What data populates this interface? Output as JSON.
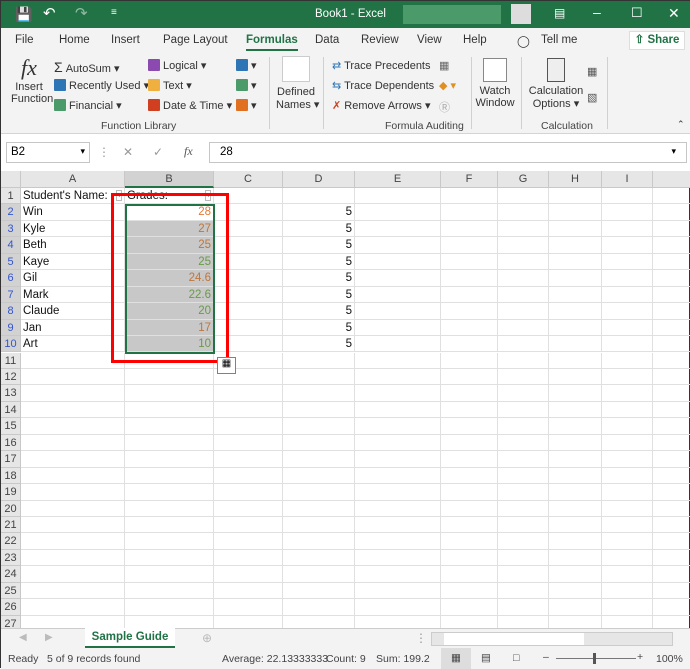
{
  "title": {
    "doc": "Book1 - Excel"
  },
  "tabs": [
    "File",
    "Home",
    "Insert",
    "Page Layout",
    "Formulas",
    "Data",
    "Review",
    "View",
    "Help",
    "Tell me"
  ],
  "share": "Share",
  "ribbon": {
    "insert_function": [
      "Insert",
      "Function"
    ],
    "autosum": "AutoSum",
    "recently_used": "Recently Used",
    "financial": "Financial",
    "logical": "Logical",
    "text": "Text",
    "date_time": "Date & Time",
    "defined_names": [
      "Defined",
      "Names"
    ],
    "trace_precedents": "Trace Precedents",
    "trace_dependents": "Trace Dependents",
    "remove_arrows": "Remove Arrows",
    "watch_window": [
      "Watch",
      "Window"
    ],
    "calc_options": [
      "Calculation",
      "Options"
    ],
    "groups": {
      "function_library": "Function Library",
      "formula_auditing": "Formula Auditing",
      "calculation": "Calculation"
    }
  },
  "formula_bar": {
    "name_box": "B2",
    "fx": "fx",
    "value": "28"
  },
  "columns": [
    "A",
    "B",
    "C",
    "D",
    "E",
    "F",
    "G",
    "H",
    "I"
  ],
  "headers": {
    "a": "Student's Name:",
    "b": "Grades:"
  },
  "rows": [
    {
      "name": "Win",
      "grade": "28",
      "color": "#e07b39",
      "d": "5"
    },
    {
      "name": "Kyle",
      "grade": "27",
      "color": "#c0753a",
      "d": "5"
    },
    {
      "name": "Beth",
      "grade": "25",
      "color": "#c0753a",
      "d": "5"
    },
    {
      "name": "Kaye",
      "grade": "25",
      "color": "#6a9a4a",
      "d": "5"
    },
    {
      "name": "Gil",
      "grade": "24.6",
      "color": "#c0753a",
      "d": "5"
    },
    {
      "name": "Mark",
      "grade": "22.6",
      "color": "#6a9a4a",
      "d": "5"
    },
    {
      "name": "Claude",
      "grade": "20",
      "color": "#6a9a4a",
      "d": "5"
    },
    {
      "name": "Jan",
      "grade": "17",
      "color": "#c0753a",
      "d": "5"
    },
    {
      "name": "Art",
      "grade": "10",
      "color": "#6a9a4a",
      "d": "5"
    }
  ],
  "sheet_tab": "Sample Guide",
  "status": {
    "ready": "Ready",
    "records": "5 of 9 records found",
    "average": "Average: 22.13333333",
    "count": "Count: 9",
    "sum": "Sum: 199.2",
    "zoom": "100%"
  }
}
